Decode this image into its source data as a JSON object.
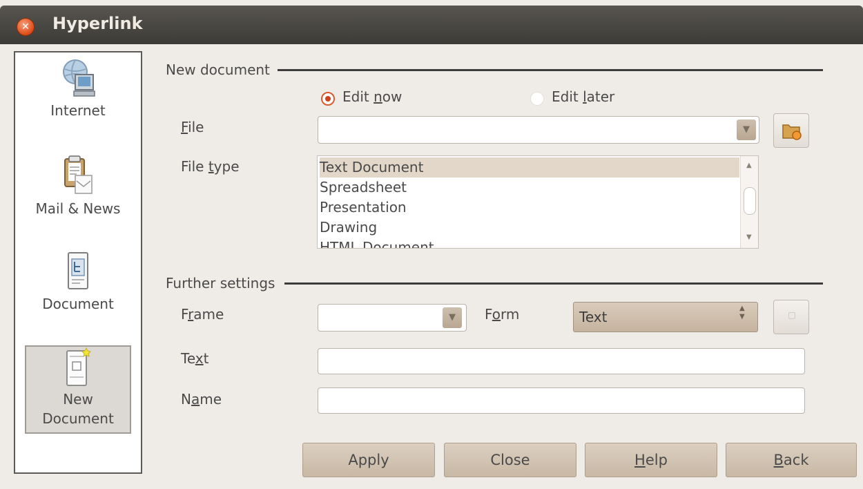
{
  "window": {
    "title": "Hyperlink"
  },
  "sidebar": {
    "items": [
      {
        "label": "Internet",
        "icon": "globe-computer-icon"
      },
      {
        "label": "Mail & News",
        "icon": "clipboard-mail-icon"
      },
      {
        "label": "Document",
        "icon": "document-icon"
      },
      {
        "label_line1": "New",
        "label_line2": "Document",
        "icon": "new-document-icon",
        "selected": true
      }
    ]
  },
  "new_document": {
    "section_title": "New document",
    "edit_now": {
      "pre": "Edit ",
      "mnemonic": "n",
      "post": "ow",
      "selected": true
    },
    "edit_later": {
      "pre": "Edit ",
      "mnemonic": "l",
      "post": "ater",
      "selected": false
    },
    "file_label": {
      "pre": "",
      "mnemonic": "F",
      "post": "ile"
    },
    "file_value": "",
    "file_type_label": {
      "pre": "File ",
      "mnemonic": "t",
      "post": "ype"
    },
    "file_types": [
      "Text Document",
      "Spreadsheet",
      "Presentation",
      "Drawing",
      "HTML Document"
    ],
    "selected_file_type": "Text Document"
  },
  "further_settings": {
    "section_title": "Further settings",
    "frame_label": {
      "pre": "F",
      "mnemonic": "r",
      "post": "ame"
    },
    "frame_value": "",
    "form_label": {
      "pre": "F",
      "mnemonic": "o",
      "post": "rm"
    },
    "form_value": "Text",
    "text_label": {
      "pre": "Te",
      "mnemonic": "x",
      "post": "t"
    },
    "text_value": "",
    "name_label": {
      "pre": "N",
      "mnemonic": "a",
      "post": "me"
    },
    "name_value": ""
  },
  "buttons": {
    "apply": "Apply",
    "close": "Close",
    "help": {
      "pre": "",
      "mnemonic": "H",
      "post": "elp"
    },
    "back": {
      "pre": "",
      "mnemonic": "B",
      "post": "ack"
    }
  },
  "colors": {
    "accent": "#d85a30",
    "titlebar": "#3c3b37",
    "button": "#c8b8a5"
  }
}
